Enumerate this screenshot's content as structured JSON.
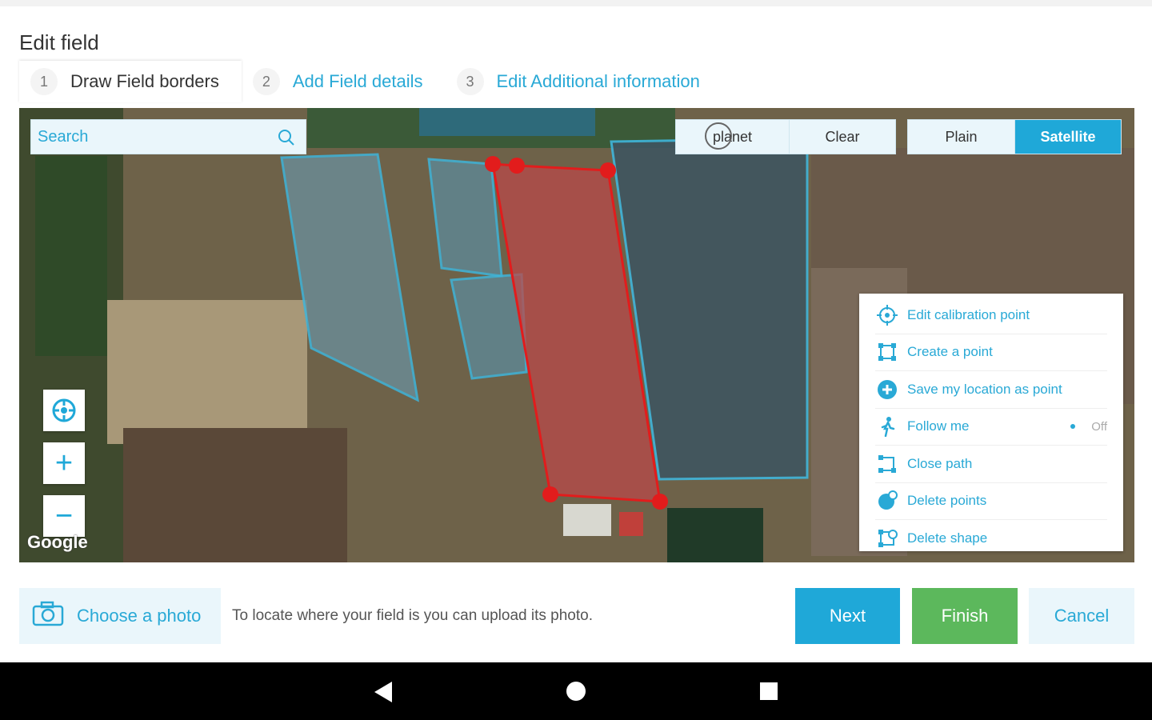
{
  "header": {
    "title": "Edit field"
  },
  "steps": [
    {
      "number": "1",
      "label": "Draw Field borders"
    },
    {
      "number": "2",
      "label": "Add Field details"
    },
    {
      "number": "3",
      "label": "Edit Additional information"
    }
  ],
  "map": {
    "search_placeholder": "Search",
    "planet_label": "planet",
    "clear_label": "Clear",
    "plain_label": "Plain",
    "satellite_label": "Satellite",
    "google_label": "Google",
    "zoom_in": "+",
    "zoom_out": "−"
  },
  "tools": [
    {
      "label": "Edit calibration point",
      "icon": "crosshair-icon"
    },
    {
      "label": "Create a point",
      "icon": "polygon-point-icon"
    },
    {
      "label": "Save my location as point",
      "icon": "plus-circle-icon"
    },
    {
      "label": "Follow me",
      "icon": "walking-icon",
      "state": "Off"
    },
    {
      "label": "Close path",
      "icon": "close-path-icon"
    },
    {
      "label": "Delete points",
      "icon": "delete-points-icon"
    },
    {
      "label": "Delete shape",
      "icon": "delete-shape-icon"
    }
  ],
  "footer": {
    "choose_photo": "Choose a photo",
    "hint": "To locate where your field is you can upload its photo.",
    "next": "Next",
    "finish": "Finish",
    "cancel": "Cancel"
  },
  "colors": {
    "accent": "#1fa8d8",
    "finish": "#5cb85c",
    "polygon": "#e21c1c"
  }
}
